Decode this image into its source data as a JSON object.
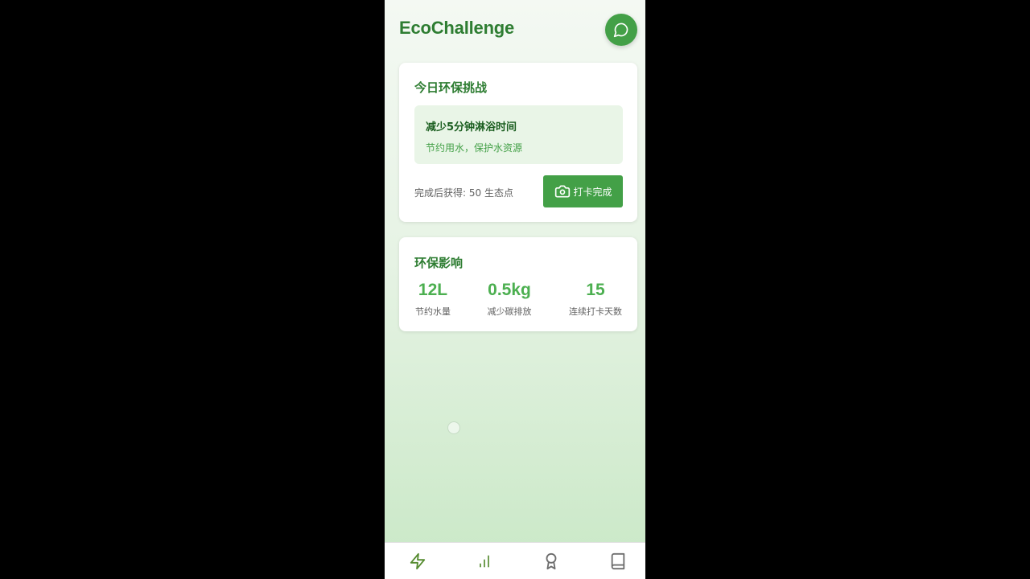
{
  "header": {
    "app_title": "EcoChallenge",
    "chat_icon": "message-circle-icon"
  },
  "challenge_card": {
    "title": "今日环保挑战",
    "challenge_name": "减少5分钟淋浴时间",
    "challenge_desc": "节约用水，保护水资源",
    "reward_text": "完成后获得: 50 生态点",
    "checkin_label": "打卡完成",
    "checkin_icon": "camera-icon"
  },
  "impact_card": {
    "title": "环保影响",
    "stats": [
      {
        "value": "12L",
        "label": "节约水量"
      },
      {
        "value": "0.5kg",
        "label": "减少碳排放"
      },
      {
        "value": "15",
        "label": "连续打卡天数"
      }
    ]
  },
  "bottom_nav": {
    "items": [
      {
        "icon": "zap-icon",
        "active": true
      },
      {
        "icon": "bar-chart-icon",
        "active": false
      },
      {
        "icon": "award-icon",
        "active": false
      },
      {
        "icon": "book-icon",
        "active": false
      }
    ]
  },
  "colors": {
    "primary": "#43a047",
    "title_green": "#2e7d32",
    "stat_green": "#4caf50",
    "nav_icon": "#558b2f",
    "nav_icon_inactive": "#6d6d6d"
  }
}
